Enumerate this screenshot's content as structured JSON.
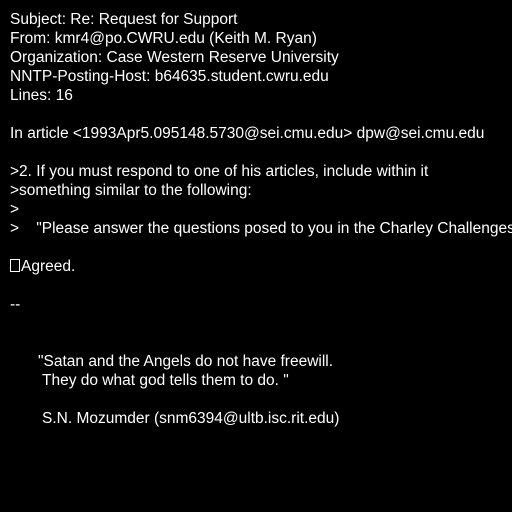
{
  "header": {
    "subject": "Subject: Re: Request for Support",
    "from": "From: kmr4@po.CWRU.edu (Keith M. Ryan)",
    "organization": "Organization: Case Western Reserve University",
    "nntp_host": "NNTP-Posting-Host: b64635.student.cwru.edu",
    "lines": "Lines: 16"
  },
  "body": {
    "attribution": "In article <1993Apr5.095148.5730@sei.cmu.edu> dpw@sei.cmu.edu",
    "quote": [
      ">2. If you must respond to one of his articles, include within it",
      ">something similar to the following:",
      ">",
      ">    \"Please answer the questions posed to you in the Charley Challenges"
    ],
    "reply": "Agreed.",
    "sig_separator": "--"
  },
  "signature": {
    "quote_line1": "\"Satan and the Angels do not have freewill.",
    "quote_line2": "They do what god tells them to do. \"",
    "author": "S.N. Mozumder (snm6394@ultb.isc.rit.edu)"
  }
}
